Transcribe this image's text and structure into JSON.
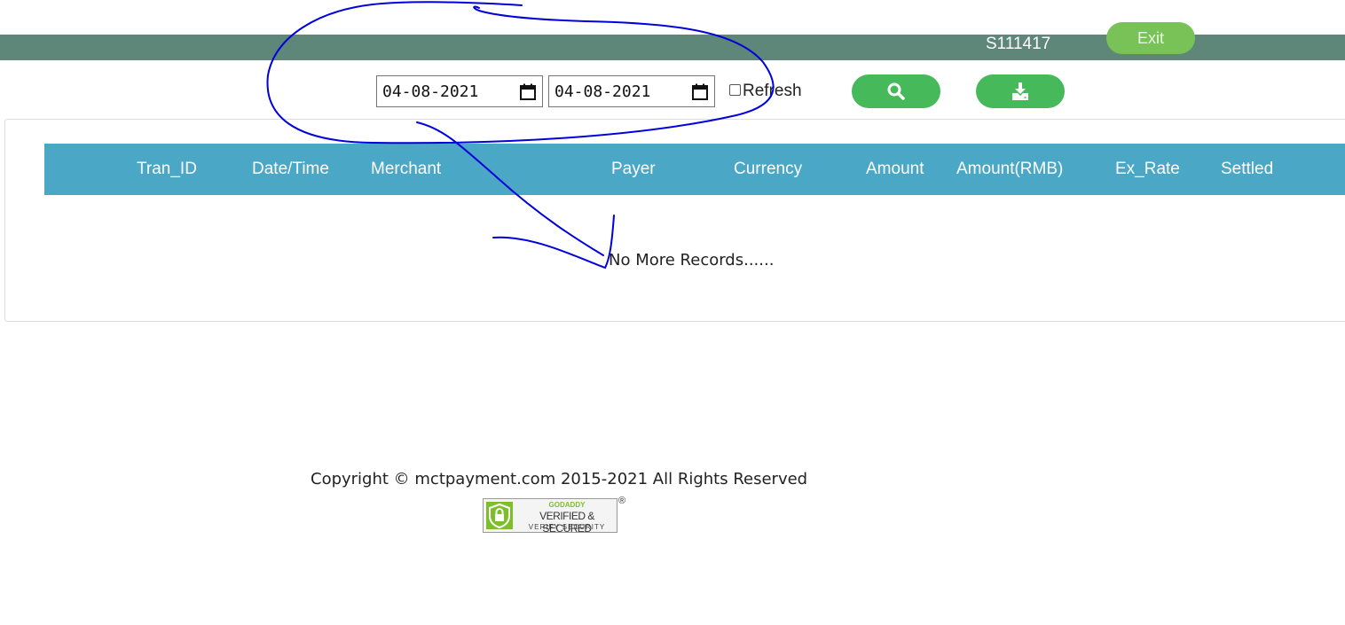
{
  "header": {
    "merchant_id": "S111417",
    "exit_label": "Exit"
  },
  "filters": {
    "from_date": "04-08-2021",
    "to_date": "04-08-2021",
    "refresh_label": "Refresh",
    "refresh_checked": false,
    "search_icon": "search-icon",
    "download_icon": "download-icon"
  },
  "table": {
    "columns": [
      "Tran_ID",
      "Date/Time",
      "Merchant",
      "Payer",
      "Currency",
      "Amount",
      "Amount(RMB)",
      "Ex_Rate",
      "Settled"
    ],
    "rows": [],
    "empty_message": "No More Records......"
  },
  "footer": {
    "copyright": "Copyright © mctpayment.com 2015-2021 All Rights Reserved",
    "seal": {
      "top": "GODADDY",
      "middle": "VERIFIED & SECURED",
      "bottom": "VERIFY SECURITY",
      "registered": "®"
    }
  },
  "colors": {
    "topbar": "#5f8779",
    "exit_button": "#79c257",
    "action_button": "#46b95a",
    "table_header": "#4aa7c5",
    "annotation_ink": "#0000dd"
  }
}
